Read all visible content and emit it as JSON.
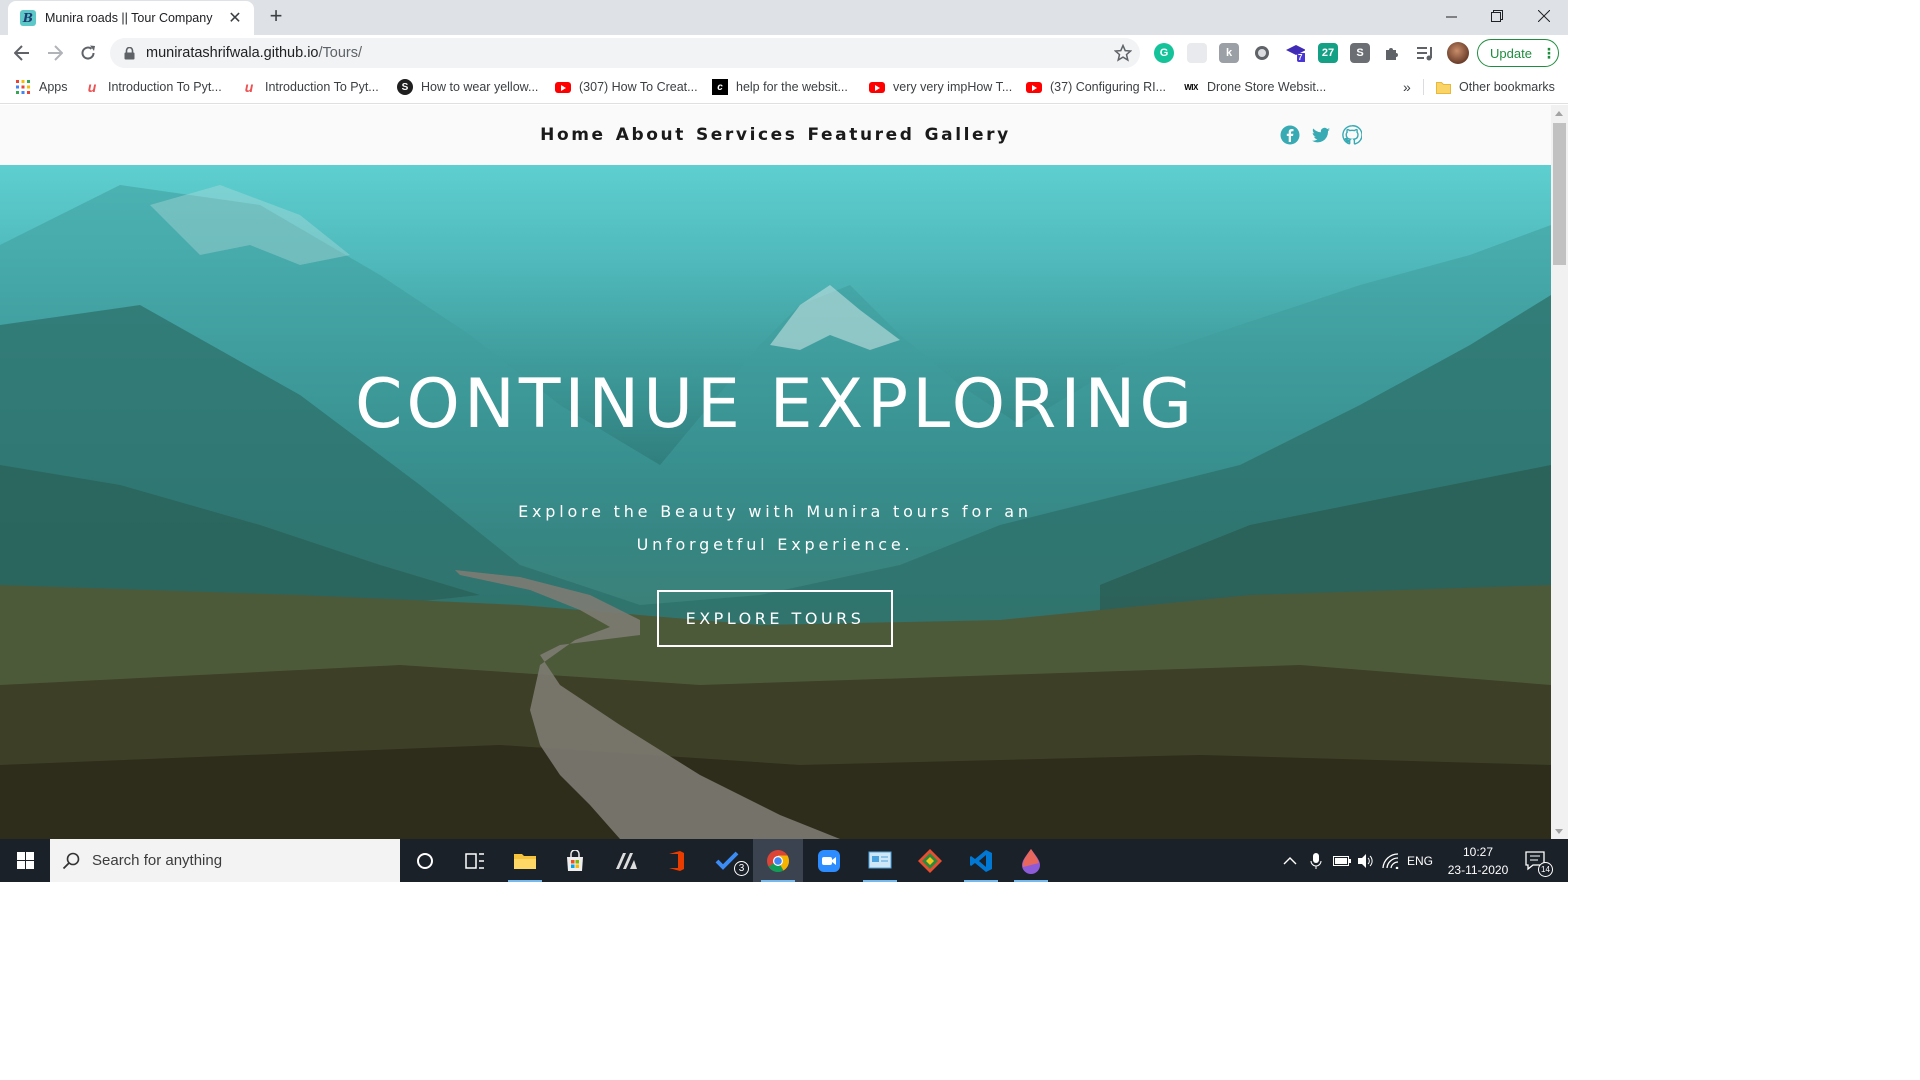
{
  "browser": {
    "tab_title": "Munira roads || Tour Company",
    "tab_favicon_letter": "B",
    "new_tab_label": "+",
    "url_host": "muniratashrifwala.github.io",
    "url_path": "/Tours/",
    "update_label": "Update",
    "extension_badge_count": "7",
    "calendar_ext_label": "27",
    "s_ext_label": "S",
    "k_ext_label": "k"
  },
  "bookmarks": {
    "apps_label": "Apps",
    "items": [
      {
        "label": "Introduction To Pyt...",
        "icon": "udemy-icon"
      },
      {
        "label": "Introduction To Pyt...",
        "icon": "udemy-icon"
      },
      {
        "label": "How to wear yellow...",
        "icon": "s-circle-icon"
      },
      {
        "label": "(307) How To Creat...",
        "icon": "youtube-icon"
      },
      {
        "label": "help for the websit...",
        "icon": "pen-icon"
      },
      {
        "label": "very very impHow T...",
        "icon": "youtube-icon"
      },
      {
        "label": "(37) Configuring RI...",
        "icon": "youtube-icon"
      },
      {
        "label": "Drone Store Websit...",
        "icon": "wix-icon"
      }
    ],
    "overflow_label": "»",
    "other_label": "Other bookmarks"
  },
  "site": {
    "nav": [
      "Home",
      "About",
      "Services",
      "Featured",
      "Gallery"
    ],
    "social": [
      "facebook-icon",
      "twitter-icon",
      "github-icon"
    ],
    "accent_color": "#38aab4",
    "hero": {
      "title": "CONTINUE EXPLORING",
      "subtitle_line1": "Explore the Beauty with Munira tours for an",
      "subtitle_line2": "Unforgetful Experience.",
      "button_label": "EXPLORE TOURS"
    }
  },
  "taskbar": {
    "search_placeholder": "Search for anything",
    "todo_badge": "3",
    "language": "ENG",
    "time": "10:27",
    "date": "23-11-2020",
    "notification_count": "14"
  }
}
